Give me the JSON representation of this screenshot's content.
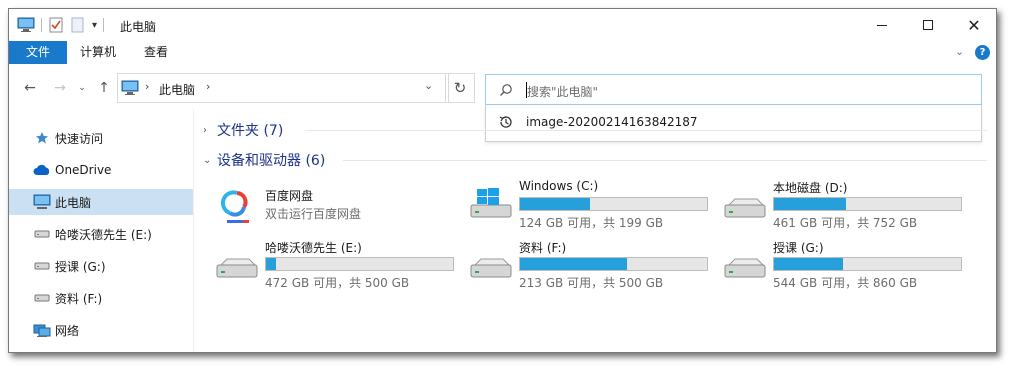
{
  "window": {
    "title": "此电脑"
  },
  "ribbon": {
    "tabs": [
      "文件",
      "计算机",
      "查看"
    ]
  },
  "address": {
    "segment": "此电脑"
  },
  "search": {
    "placeholder": "搜索\"此电脑\"",
    "suggestion": "image-20200214163842187"
  },
  "sidebar": {
    "items": [
      {
        "label": "快速访问",
        "icon": "star-icon"
      },
      {
        "label": "OneDrive",
        "icon": "cloud-icon"
      },
      {
        "label": "此电脑",
        "icon": "computer-icon",
        "selected": true
      },
      {
        "label": "哈喽沃德先生 (E:)",
        "icon": "drive-icon"
      },
      {
        "label": "授课 (G:)",
        "icon": "drive-icon"
      },
      {
        "label": "资料 (F:)",
        "icon": "drive-icon"
      },
      {
        "label": "网络",
        "icon": "network-icon"
      }
    ]
  },
  "groups": {
    "folders": {
      "label": "文件夹 (7)",
      "expanded": false
    },
    "devices": {
      "label": "设备和驱动器 (6)",
      "expanded": true
    }
  },
  "devices": {
    "baidu": {
      "name": "百度网盘",
      "subtitle": "双击运行百度网盘"
    },
    "drives": [
      {
        "name": "Windows (C:)",
        "usage": "124 GB 可用，共 199 GB",
        "used_fraction": 0.377,
        "color": "#26a0da"
      },
      {
        "name": "本地磁盘 (D:)",
        "usage": "461 GB 可用，共 752 GB",
        "used_fraction": 0.387,
        "color": "#26a0da"
      },
      {
        "name": "哈喽沃德先生 (E:)",
        "usage": "472 GB 可用，共 500 GB",
        "used_fraction": 0.056,
        "color": "#26a0da"
      },
      {
        "name": "资料 (F:)",
        "usage": "213 GB 可用，共 500 GB",
        "used_fraction": 0.574,
        "color": "#26a0da"
      },
      {
        "name": "授课 (G:)",
        "usage": "544 GB 可用，共 860 GB",
        "used_fraction": 0.367,
        "color": "#26a0da"
      }
    ]
  },
  "colors": {
    "accent": "#1979ca",
    "selection": "#cce0f4",
    "bar_fill": "#26a0da",
    "group_header": "#1e3287"
  }
}
